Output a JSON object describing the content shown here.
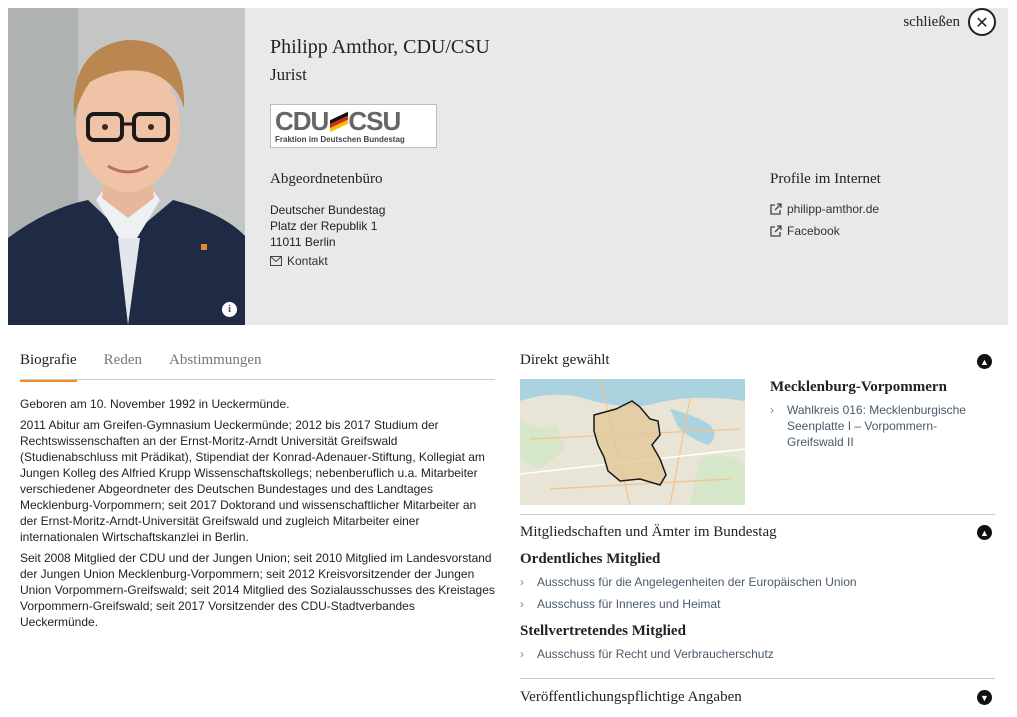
{
  "header": {
    "close_label": "schließen",
    "name": "Philipp Amthor, CDU/CSU",
    "profession": "Jurist",
    "party_logo": {
      "main_left": "CDU",
      "main_right": "CSU",
      "subtitle": "Fraktion im Deutschen Bundestag"
    },
    "office": {
      "title": "Abgeordnetenbüro",
      "lines": [
        "Deutscher Bundestag",
        "Platz der Republik 1",
        "11011 Berlin"
      ],
      "contact_label": "Kontakt"
    },
    "profiles": {
      "title": "Profile im Internet",
      "links": [
        {
          "label": "philipp-amthor.de",
          "icon": "external-link-icon"
        },
        {
          "label": "Facebook",
          "icon": "external-link-icon"
        }
      ]
    },
    "photo_info_icon": "info-icon"
  },
  "tabs": [
    {
      "label": "Biografie",
      "active": true
    },
    {
      "label": "Reden",
      "active": false
    },
    {
      "label": "Abstimmungen",
      "active": false
    }
  ],
  "biography": [
    "Geboren am 10. November 1992 in Ueckermünde.",
    "2011 Abitur am Greifen-Gymnasium Ueckermünde; 2012 bis 2017 Studium der Rechtswissenschaften an der Ernst-Moritz-Arndt Universität Greifswald (Studienabschluss mit Prädikat), Stipendiat der Konrad-Adenauer-Stiftung, Kollegiat am Jungen Kolleg des Alfried Krupp Wissenschaftskollegs; nebenberuflich u.a. Mitarbeiter verschiedener Abgeordneter des Deutschen Bundestages und des Landtages Mecklenburg-Vorpommern; seit 2017 Doktorand und wissenschaftlicher Mitarbeiter an der Ernst-Moritz-Arndt-Universität Greifswald und zugleich Mitarbeiter einer internationalen Wirtschaftskanzlei in Berlin.",
    "Seit 2008 Mitglied der CDU und der Jungen Union; seit 2010 Mitglied im Landesvorstand der Jungen Union Mecklenburg-Vorpommern; seit 2012 Kreisvorsitzender der Jungen Union Vorpommern-Greifswald; seit 2014 Mitglied des Sozialausschusses des Kreistages Vorpommern-Greifswald; seit 2017 Vorsitzender des CDU-Stadtverbandes Ueckermünde."
  ],
  "direct": {
    "title": "Direkt gewählt",
    "region": "Mecklenburg-Vorpommern",
    "constituency_lines": [
      "Wahlkreis 016: Mecklenburgische",
      "Seenplatte I – Vorpommern-",
      "Greifswald II"
    ],
    "toggle_state": "expanded"
  },
  "memberships": {
    "title": "Mitgliedschaften und Ämter im Bundestag",
    "toggle_state": "expanded",
    "full_member_heading": "Ordentliches Mitglied",
    "full_member": [
      "Ausschuss für die Angelegenheiten der Europäischen Union",
      "Ausschuss für Inneres und Heimat"
    ],
    "deputy_heading": "Stellvertretendes Mitglied",
    "deputy": [
      "Ausschuss für Recht und Verbraucherschutz"
    ]
  },
  "disclosures": {
    "title": "Veröffentlichungspflichtige Angaben",
    "toggle_state": "collapsed"
  },
  "colors": {
    "header_bg": "#e9e9e9",
    "tab_accent": "#f08a24",
    "link_text": "#4a5a6a"
  }
}
